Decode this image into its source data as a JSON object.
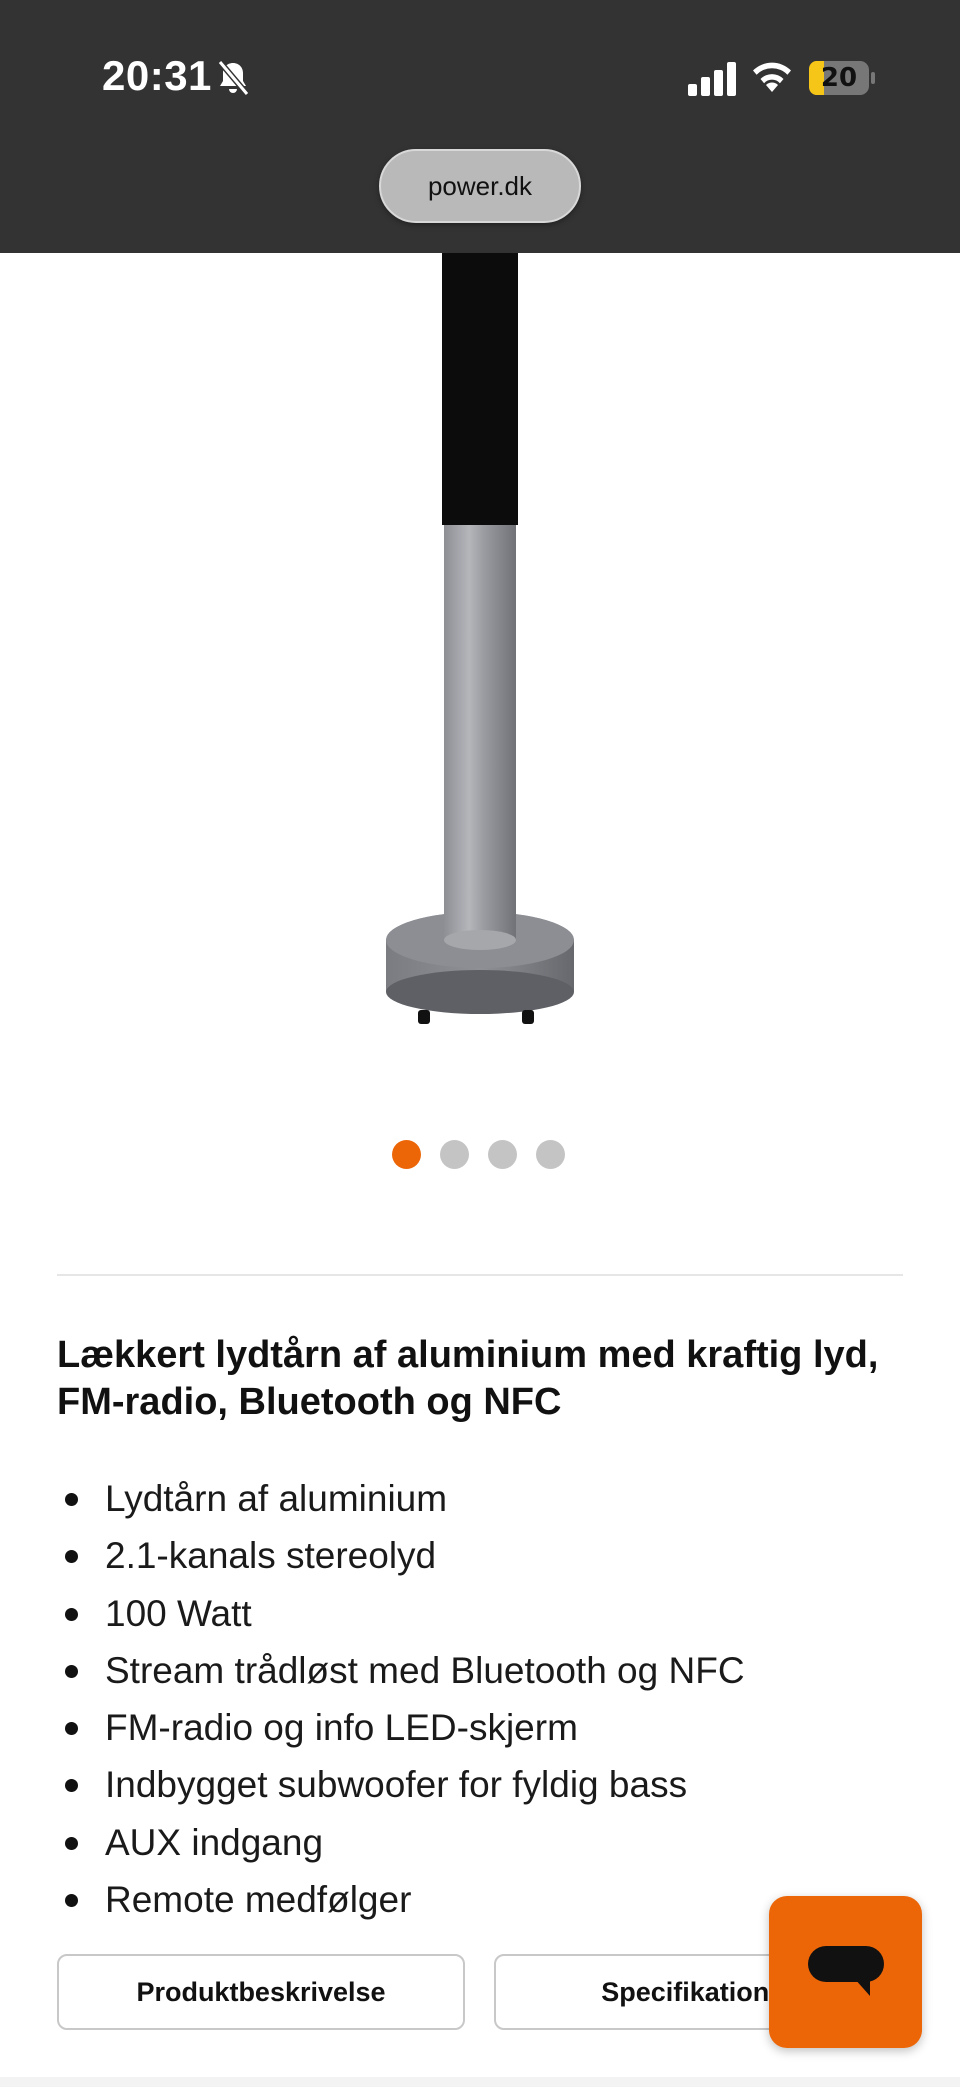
{
  "status_bar": {
    "time": "20:31",
    "battery": "20"
  },
  "browser": {
    "url": "power.dk"
  },
  "product": {
    "image_icon": "speaker-tower-image",
    "carousel": {
      "count": 4,
      "active_index": 0
    },
    "headline": "Lækkert lydtårn af aluminium med kraftig lyd, FM-radio, Bluetooth og NFC",
    "features": [
      "Lydtårn af aluminium",
      "2.1-kanals stereolyd",
      "100 Watt",
      "Stream trådløst med Bluetooth og NFC",
      "FM-radio og info LED-skjerm",
      "Indbygget subwoofer for fyldig bass",
      "AUX indgang",
      "Remote medfølger"
    ]
  },
  "tabs": {
    "description_label": "Produktbeskrivelse",
    "specs_label": "Specifikationer"
  },
  "chat": {
    "icon": "chat-bubble-icon"
  },
  "colors": {
    "accent": "#ec6608",
    "topbar": "#333333",
    "dot_inactive": "#c4c4c4"
  }
}
